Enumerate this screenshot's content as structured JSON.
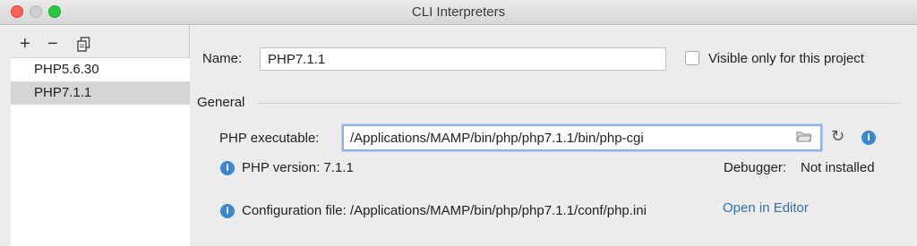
{
  "window": {
    "title": "CLI Interpreters"
  },
  "toolbar": {
    "add_icon": "+",
    "remove_icon": "−"
  },
  "interpreters": [
    {
      "label": "PHP5.6.30"
    },
    {
      "label": "PHP7.1.1",
      "selected": true
    }
  ],
  "form": {
    "name_label": "Name:",
    "name_value": "PHP7.1.1",
    "visible_label": "Visible only for this project",
    "visible_checked": false
  },
  "general": {
    "title": "General",
    "executable_label": "PHP executable:",
    "executable_value": "/Applications/MAMP/bin/php/php7.1.1/bin/php-cgi",
    "php_version": "PHP version: 7.1.1",
    "debugger_label": "Debugger:",
    "debugger_value": "Not installed",
    "config_file": "Configuration file: /Applications/MAMP/bin/php/php7.1.1/conf/php.ini",
    "open_in_editor": "Open in Editor"
  },
  "icons": {
    "info": "i",
    "refresh": "↻"
  },
  "colors": {
    "selection": "#d5d5d5",
    "link": "#2f6fb5",
    "info_icon": "#3a87cf",
    "focus_ring": "#8db2e3"
  }
}
